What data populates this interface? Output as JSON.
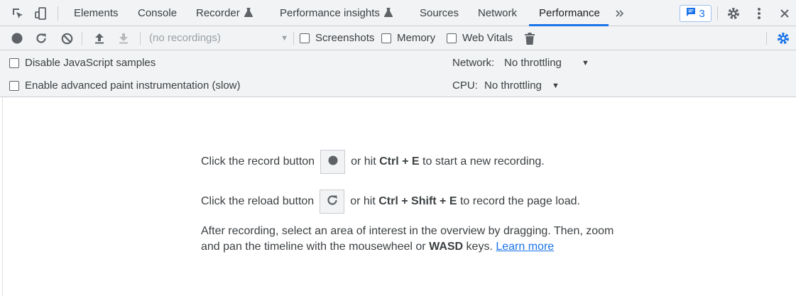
{
  "tabs": [
    {
      "label": "Elements"
    },
    {
      "label": "Console"
    },
    {
      "label": "Recorder"
    },
    {
      "label": "Performance insights"
    },
    {
      "label": "Sources"
    },
    {
      "label": "Network"
    },
    {
      "label": "Performance"
    }
  ],
  "tabs_active": "Performance",
  "issues_badge": {
    "count": "3"
  },
  "toolbar": {
    "recordings_select": "(no recordings)",
    "screenshots_label": "Screenshots",
    "memory_label": "Memory",
    "web_vitals_label": "Web Vitals"
  },
  "settings": {
    "disable_js_samples": "Disable JavaScript samples",
    "enable_paint": "Enable advanced paint instrumentation (slow)",
    "network_label": "Network:",
    "network_value": "No throttling",
    "cpu_label": "CPU:",
    "cpu_value": "No throttling"
  },
  "landing": {
    "record_prefix": "Click the record button",
    "record_mid": "or hit",
    "record_key1": "Ctrl",
    "record_key2": "E",
    "record_suffix": "to start a new recording.",
    "reload_prefix": "Click the reload button",
    "reload_mid": "or hit",
    "reload_key1": "Ctrl",
    "reload_key2": "Shift",
    "reload_key3": "E",
    "reload_suffix": "to record the page load.",
    "para_part1": "After recording, select an area of interest in the overview by dragging. Then, zoom and pan the timeline with the mousewheel or",
    "para_key": "WASD",
    "para_part2": "keys.",
    "learn_more": "Learn more",
    "plus": "+"
  },
  "colors": {
    "accent": "#1a73e8",
    "toolbar_bg": "#f1f3f4",
    "border": "#cbcdd1"
  }
}
